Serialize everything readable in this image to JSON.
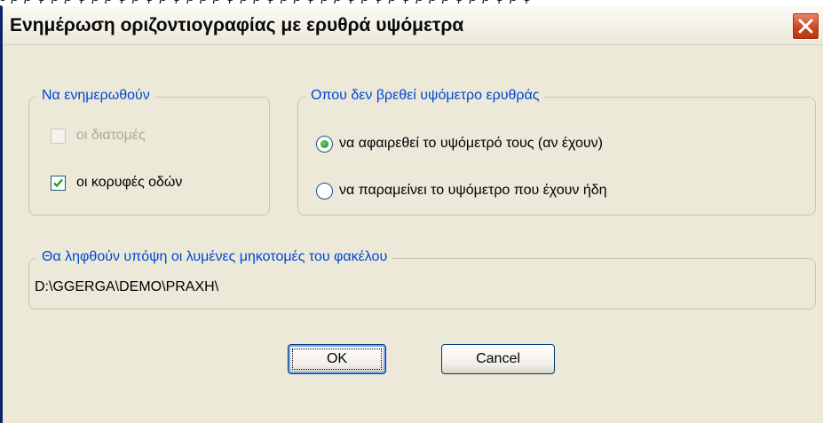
{
  "window": {
    "title": "Ενημέρωση οριζοντιογραφίας με ερυθρά υψόμετρα"
  },
  "group_update": {
    "legend": "Να ενημερωθούν",
    "items": [
      {
        "label": "οι διατομές",
        "checked": false,
        "enabled": false
      },
      {
        "label": "οι κορυφές οδών",
        "checked": true,
        "enabled": true
      }
    ]
  },
  "group_noelev": {
    "legend": "Οπου δεν βρεθεί υψόμετρο ερυθράς",
    "options": [
      {
        "label": "να αφαιρεθεί το υψόμετρό τους (αν έχουν)",
        "selected": true
      },
      {
        "label": "να παραμείνει το υψόμετρο που έχουν ήδη",
        "selected": false
      }
    ]
  },
  "group_folder": {
    "legend": "Θα ληφθούν υπόψη οι λυμένες μηκοτομές του φακέλου",
    "path": "D:\\GGERGA\\DEMO\\PRAXH\\"
  },
  "buttons": {
    "ok": "OK",
    "cancel": "Cancel"
  },
  "colors": {
    "dialog_bg": "#ece9d8",
    "legend_blue": "#0046d5",
    "close_red": "#c8431f"
  },
  "icons": {
    "close": "close-icon",
    "check": "checkmark-icon"
  }
}
